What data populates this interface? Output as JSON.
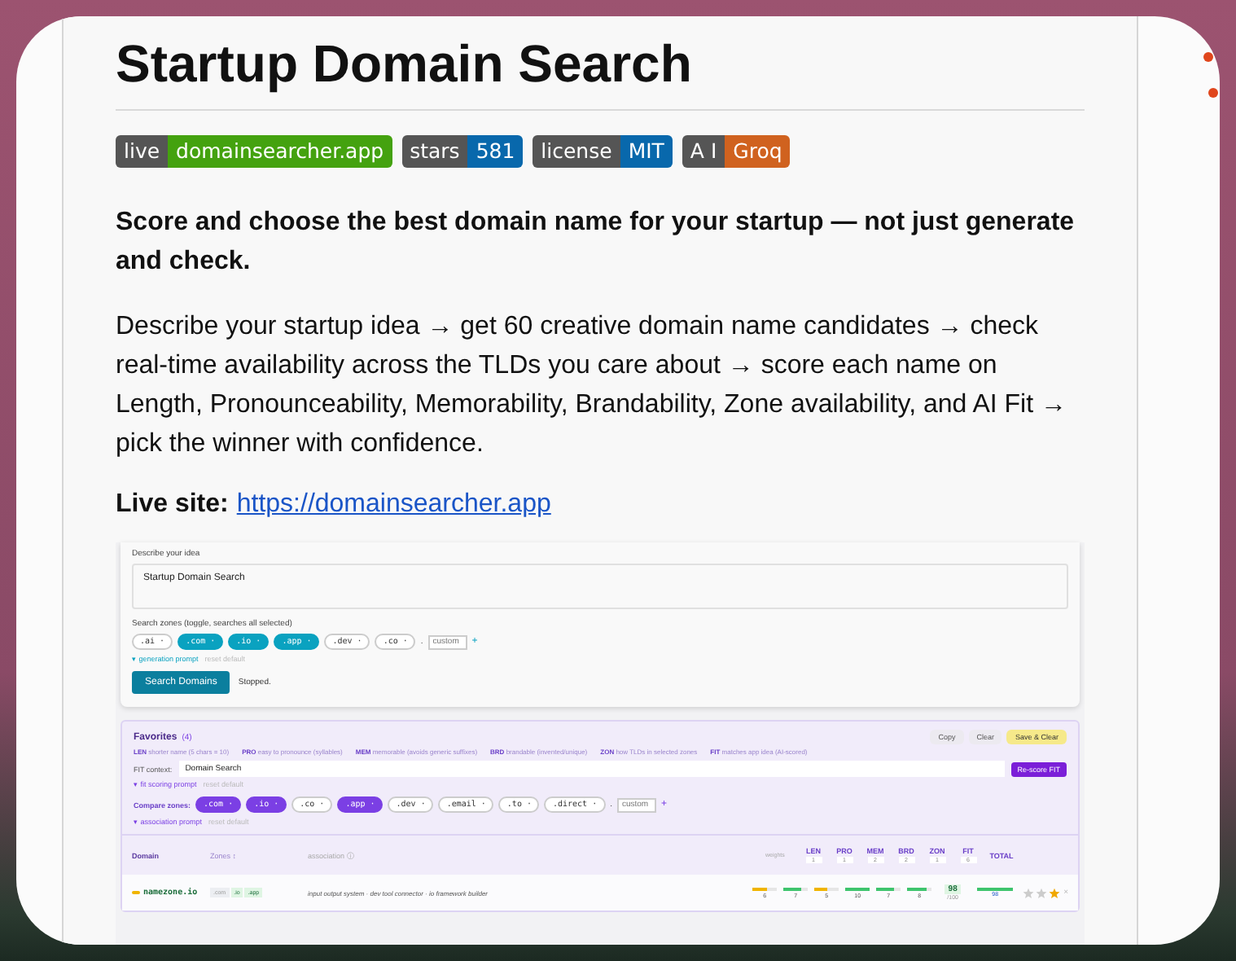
{
  "title": "Startup Domain Search",
  "badges": [
    {
      "label": "live",
      "value": "domainsearcher.app",
      "color": "#44a20f"
    },
    {
      "label": "stars",
      "value": "581",
      "color": "#0868ac"
    },
    {
      "label": "license",
      "value": "MIT",
      "color": "#0868ac"
    },
    {
      "label": "A I",
      "value": "Groq",
      "color": "#d0621f"
    }
  ],
  "tagline": "Score and choose the best domain name for your startup — not just generate and check.",
  "description": "Describe your startup idea → get 60 creative domain name candidates → check real-time availability across the TLDs you care about → score each name on Length, Pronounceability, Memorability, Brandability, Zone availability, and AI Fit → pick the winner with confidence.",
  "live_site": {
    "label": "Live site:",
    "link": "https://domainsearcher.app"
  },
  "preview": {
    "idea_label": "Describe your idea",
    "idea_value": "Startup Domain Search",
    "zones_label": "Search zones (toggle, searches all selected)",
    "zones": [
      {
        "label": ".ai ·",
        "selected": false
      },
      {
        "label": ".com ·",
        "selected": true
      },
      {
        "label": ".io ·",
        "selected": true
      },
      {
        "label": ".app ·",
        "selected": true
      },
      {
        "label": ".dev ·",
        "selected": false
      },
      {
        "label": ".co ·",
        "selected": false
      }
    ],
    "separator": ".",
    "custom_placeholder": "custom",
    "add": "+",
    "prompt_toggle": "▾ generation prompt",
    "reset": "reset default",
    "search_button": "Search Domains",
    "status": "Stopped.",
    "favorites": {
      "title": "Favorites",
      "count": "(4)",
      "legend": [
        {
          "code": "LEN",
          "text": "shorter name (5 chars = 10)"
        },
        {
          "code": "PRO",
          "text": "easy to pronounce (syllables)"
        },
        {
          "code": "MEM",
          "text": "memorable (avoids generic suffixes)"
        },
        {
          "code": "BRD",
          "text": "brandable (invented/unique)"
        },
        {
          "code": "ZON",
          "text": "how TLDs in selected zones"
        },
        {
          "code": "FIT",
          "text": "matches app idea (AI-scored)"
        }
      ],
      "buttons": [
        {
          "label": "Copy",
          "kind": "plain"
        },
        {
          "label": "Clear",
          "kind": "plain"
        },
        {
          "label": "Save & Clear",
          "kind": "accent"
        }
      ],
      "fit_label": "FIT context:",
      "fit_value": "Domain Search",
      "rescore_button": "Re-score FIT",
      "fit_prompt": "▾ fit scoring prompt",
      "fit_reset": "reset default",
      "compare_label": "Compare zones:",
      "compare_zones": [
        {
          "label": ".com ·",
          "selected": true
        },
        {
          "label": ".io ·",
          "selected": true
        },
        {
          "label": ".co ·",
          "selected": false
        },
        {
          "label": ".app ·",
          "selected": true
        },
        {
          "label": ".dev ·",
          "selected": false
        },
        {
          "label": ".email ·",
          "selected": false
        },
        {
          "label": ".to ·",
          "selected": false
        },
        {
          "label": ".direct ·",
          "selected": false
        }
      ],
      "separator": ".",
      "custom_placeholder": "custom",
      "add": "+",
      "association_prompt": "▾ association prompt",
      "association_reset": "reset default",
      "table": {
        "domain_column": "Domain",
        "zones_column": "Zones ↕",
        "association_column": "association ⓘ",
        "weights_label": "weights",
        "score_columns": [
          {
            "label": "LEN",
            "weight": "1"
          },
          {
            "label": "PRO",
            "weight": "1"
          },
          {
            "label": "MEM",
            "weight": "2"
          },
          {
            "label": "BRD",
            "weight": "2"
          },
          {
            "label": "ZON",
            "weight": "1"
          },
          {
            "label": "FIT",
            "weight": "6"
          }
        ],
        "total_column": "TOTAL",
        "rows": [
          {
            "domain": "namezone.io",
            "zones": [
              {
                "label": ".com",
                "available": false
              },
              {
                "label": ".io",
                "available": true
              },
              {
                "label": ".app",
                "available": true
              }
            ],
            "association": "input output system · dev tool connector · io framework builder",
            "scores": [
              {
                "value": "6",
                "level": 0.6,
                "color": "#f0b400"
              },
              {
                "value": "7",
                "level": 0.7,
                "color": "#3ec46d"
              },
              {
                "value": "5",
                "level": 0.5,
                "color": "#f0b400"
              },
              {
                "value": "10",
                "level": 1,
                "color": "#3ec46d"
              },
              {
                "value": "7",
                "level": 0.7,
                "color": "#3ec46d"
              },
              {
                "value": "8",
                "level": 0.8,
                "color": "#3ec46d"
              }
            ],
            "total": "98",
            "total_sub": "/100",
            "bar_value": "98",
            "stars": 1,
            "remove": "×"
          }
        ]
      }
    }
  }
}
